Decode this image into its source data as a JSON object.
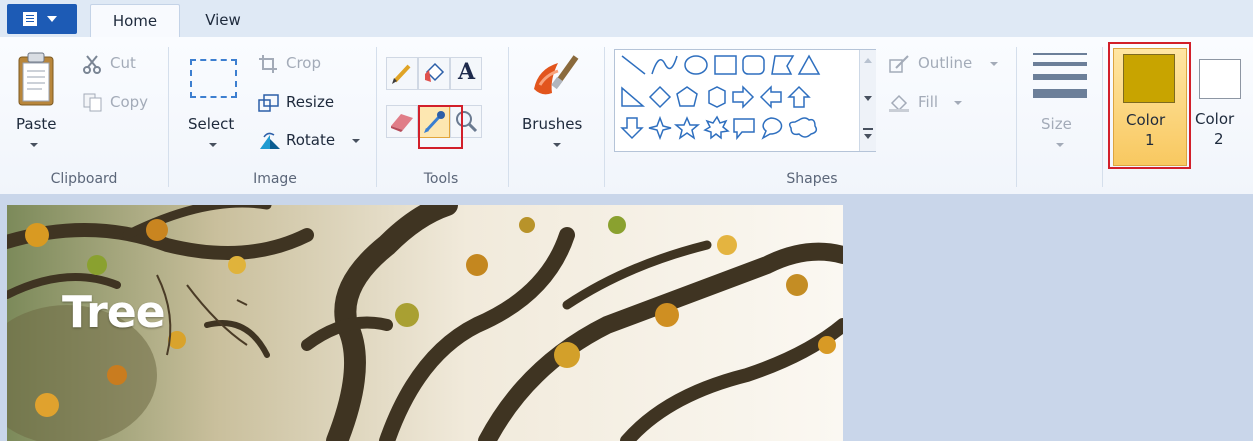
{
  "tabs": {
    "home": "Home",
    "view": "View"
  },
  "clipboard": {
    "paste": "Paste",
    "cut": "Cut",
    "copy": "Copy",
    "group_label": "Clipboard"
  },
  "image": {
    "select": "Select",
    "crop": "Crop",
    "resize": "Resize",
    "rotate": "Rotate",
    "group_label": "Image"
  },
  "tools": {
    "group_label": "Tools",
    "text_tool_glyph": "A",
    "icons": [
      "pencil-icon",
      "fill-bucket-icon",
      "text-icon",
      "eraser-icon",
      "color-picker-icon",
      "magnifier-icon"
    ]
  },
  "brushes": {
    "label": "Brushes"
  },
  "shapes": {
    "outline": "Outline",
    "fill": "Fill",
    "group_label": "Shapes"
  },
  "size": {
    "label": "Size"
  },
  "colors": {
    "color1_line1": "Color",
    "color1_line2": "1",
    "color2_line1": "Color",
    "color2_line2": "2",
    "color1_value": "#c8a400",
    "color2_value": "#ffffff"
  },
  "canvas": {
    "image_text": "Tree"
  },
  "accent": {
    "highlight": "#d21f2a",
    "app_menu": "#1d5bb5"
  }
}
